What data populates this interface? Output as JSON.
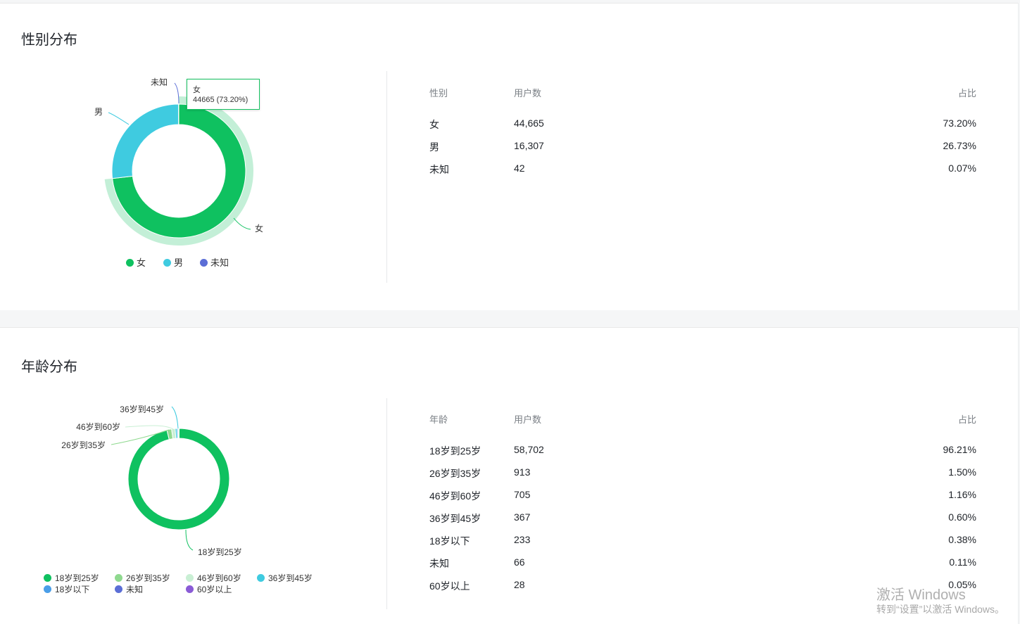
{
  "gender": {
    "title": "性别分布",
    "tooltip": {
      "name": "女",
      "value": "44665 (73.20%)"
    },
    "chart_labels": [
      "未知",
      "男",
      "女"
    ],
    "legend": [
      {
        "label": "女",
        "color": "#0fc160"
      },
      {
        "label": "男",
        "color": "#3fcbe0"
      },
      {
        "label": "未知",
        "color": "#5b6ed6"
      }
    ],
    "table": {
      "headers": [
        "性别",
        "用户数",
        "占比"
      ],
      "rows": [
        [
          "女",
          "44,665",
          "73.20%"
        ],
        [
          "男",
          "16,307",
          "26.73%"
        ],
        [
          "未知",
          "42",
          "0.07%"
        ]
      ]
    }
  },
  "age": {
    "title": "年龄分布",
    "chart_labels": [
      "36岁到45岁",
      "46岁到60岁",
      "26岁到35岁",
      "18岁到25岁"
    ],
    "legend": [
      {
        "label": "18岁到25岁",
        "color": "#0fc160"
      },
      {
        "label": "26岁到35岁",
        "color": "#8fd98f"
      },
      {
        "label": "46岁到60岁",
        "color": "#c9efd4"
      },
      {
        "label": "36岁到45岁",
        "color": "#3fcbe0"
      },
      {
        "label": "18岁以下",
        "color": "#4a9ee8"
      },
      {
        "label": "未知",
        "color": "#5b6ed6"
      },
      {
        "label": "60岁以上",
        "color": "#8a5bd6"
      }
    ],
    "table": {
      "headers": [
        "年龄",
        "用户数",
        "占比"
      ],
      "rows": [
        [
          "18岁到25岁",
          "58,702",
          "96.21%"
        ],
        [
          "26岁到35岁",
          "913",
          "1.50%"
        ],
        [
          "46岁到60岁",
          "705",
          "1.16%"
        ],
        [
          "36岁到45岁",
          "367",
          "0.60%"
        ],
        [
          "18岁以下",
          "233",
          "0.38%"
        ],
        [
          "未知",
          "66",
          "0.11%"
        ],
        [
          "60岁以上",
          "28",
          "0.05%"
        ]
      ]
    }
  },
  "chart_data": [
    {
      "type": "pie",
      "donut": true,
      "categories": [
        "女",
        "男",
        "未知"
      ],
      "values": [
        44665,
        16307,
        42
      ],
      "percentages": [
        73.2,
        26.73,
        0.07
      ],
      "colors": [
        "#0fc160",
        "#3fcbe0",
        "#5b6ed6"
      ],
      "highlighted": "女",
      "legend_position": "bottom"
    },
    {
      "type": "pie",
      "donut": true,
      "categories": [
        "18岁到25岁",
        "26岁到35岁",
        "46岁到60岁",
        "36岁到45岁",
        "18岁以下",
        "未知",
        "60岁以上"
      ],
      "values": [
        58702,
        913,
        705,
        367,
        233,
        66,
        28
      ],
      "percentages": [
        96.21,
        1.5,
        1.16,
        0.6,
        0.38,
        0.11,
        0.05
      ],
      "colors": [
        "#0fc160",
        "#8fd98f",
        "#c9efd4",
        "#3fcbe0",
        "#4a9ee8",
        "#5b6ed6",
        "#8a5bd6"
      ],
      "legend_position": "bottom"
    }
  ],
  "watermark": {
    "line1": "激活 Windows",
    "line2": "转到“设置”以激活 Windows。"
  }
}
